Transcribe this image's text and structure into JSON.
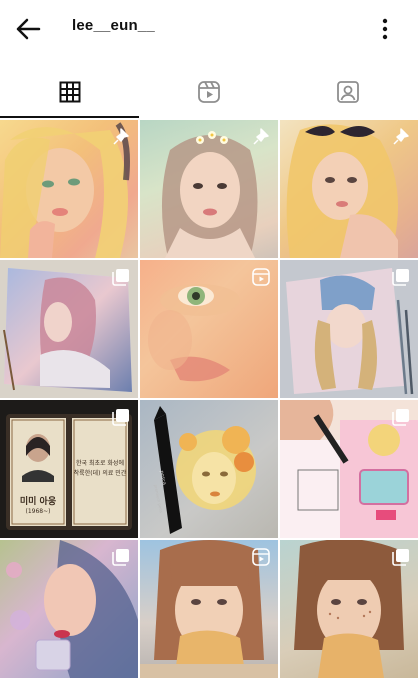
{
  "header": {
    "username": "lee__eun__"
  },
  "icons": {
    "back": "arrow-left-icon",
    "more": "more-vertical-icon",
    "grid": "grid-icon",
    "reels": "reels-icon",
    "tagged": "tagged-person-icon",
    "pin": "pin-icon",
    "multi": "multiple-photos-icon",
    "reel": "reel-icon"
  },
  "posts": [
    {
      "badge": "pin",
      "alt": "blonde girl portrait"
    },
    {
      "badge": "pin",
      "alt": "girl with flower crown"
    },
    {
      "badge": "pin",
      "alt": "girl with black bow"
    },
    {
      "badge": "multi",
      "alt": "watercolor girl in scarf"
    },
    {
      "badge": "reel",
      "alt": "close up eye"
    },
    {
      "badge": "multi",
      "alt": "girl in blue hat"
    },
    {
      "badge": "multi",
      "alt": "book painting"
    },
    {
      "badge": "none",
      "alt": "golden portrait with marker"
    },
    {
      "badge": "multi",
      "alt": "coloring book"
    },
    {
      "badge": "multi",
      "alt": "girl with perfume"
    },
    {
      "badge": "reel",
      "alt": "girl eating bread"
    },
    {
      "badge": "multi",
      "alt": "freckled girl eating bread"
    }
  ],
  "book": {
    "name": "미미 아웅",
    "years": "(1968~)",
    "line1": "한국 최초로 화성에",
    "line2": "착륙한(데) 의료 민간"
  },
  "marker": {
    "brand": "posca",
    "line": "premium pens"
  }
}
